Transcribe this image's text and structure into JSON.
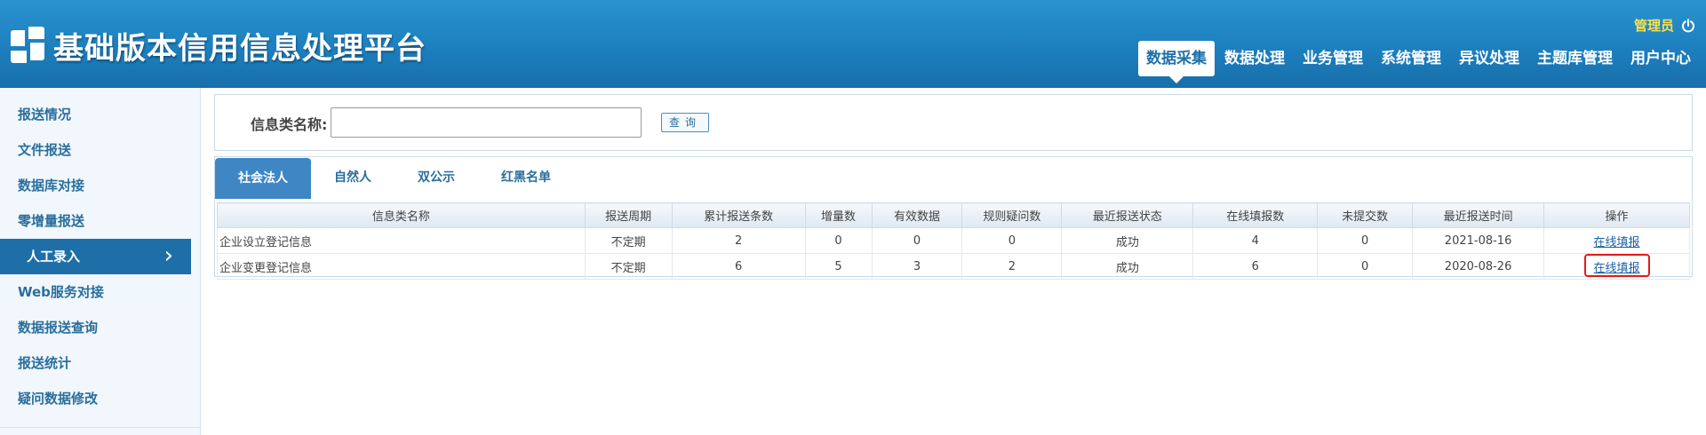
{
  "header": {
    "title": "基础版本信用信息处理平台",
    "user_name": "管理员",
    "logo_icon": "logo-mark-icon",
    "logout_icon": "power-icon",
    "nav": [
      "数据采集",
      "数据处理",
      "业务管理",
      "系统管理",
      "异议处理",
      "主题库管理",
      "用户中心"
    ],
    "active_nav": "数据采集"
  },
  "sidebar": {
    "items": [
      "报送情况",
      "文件报送",
      "数据库对接",
      "零增量报送",
      "人工录入",
      "Web服务对接",
      "数据报送查询",
      "报送统计",
      "疑问数据修改"
    ],
    "active_item": "人工录入",
    "active_chevron": "›"
  },
  "search": {
    "label": "信息类名称:",
    "value": "",
    "placeholder": "",
    "button_label": "查询"
  },
  "tabs": {
    "items": [
      "社会法人",
      "自然人",
      "双公示",
      "红黑名单"
    ],
    "active": "社会法人"
  },
  "table": {
    "columns": [
      "信息类名称",
      "报送周期",
      "累计报送条数",
      "增量数",
      "有效数据",
      "规则疑问数",
      "最近报送状态",
      "在线填报数",
      "未提交数",
      "最近报送时间",
      "操作"
    ],
    "rows": [
      [
        "企业设立登记信息",
        "不定期",
        "2",
        "0",
        "0",
        "0",
        "成功",
        "4",
        "0",
        "2021-08-16",
        "在线填报"
      ],
      [
        "企业变更登记信息",
        "不定期",
        "6",
        "5",
        "3",
        "2",
        "成功",
        "6",
        "0",
        "2020-08-26",
        "在线填报"
      ]
    ]
  },
  "colors": {
    "header_blue": "#1d7fbe",
    "sidebar_active": "#1e6fa8",
    "success_green": "#2c9a2c",
    "error_red": "#e02020",
    "highlight_red": "#e41919",
    "user_yellow": "#f7e14a"
  }
}
